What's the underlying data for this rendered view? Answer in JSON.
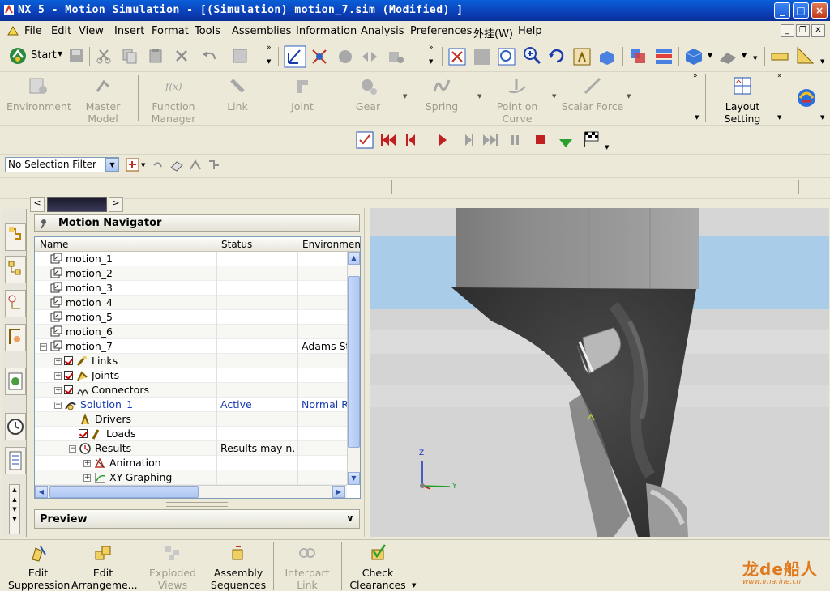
{
  "window": {
    "title": "NX 5 - Motion Simulation - [(Simulation) motion_7.sim (Modified) ]",
    "controls": [
      "_",
      "□",
      "×"
    ]
  },
  "menubar": {
    "items": [
      "File",
      "Edit",
      "View",
      "Insert",
      "Format",
      "Tools",
      "Assemblies",
      "Information",
      "Analysis",
      "Preferences",
      "外挂(W)",
      "Help"
    ]
  },
  "standard_toolbar": {
    "start_label": "Start"
  },
  "motion_toolbar": {
    "items": [
      {
        "label": "Environment"
      },
      {
        "label": "Master Model"
      },
      {
        "label": "Function Manager"
      },
      {
        "label": "Link"
      },
      {
        "label": "Joint"
      },
      {
        "label": "Gear"
      },
      {
        "label": "Spring"
      },
      {
        "label": "Point on Curve"
      },
      {
        "label": "Scalar Force"
      }
    ],
    "layout_setting": "Layout Setting"
  },
  "selection": {
    "filter_value": "No Selection Filter"
  },
  "navigator": {
    "title": "Motion Navigator",
    "columns": [
      "Name",
      "Status",
      "Environment"
    ],
    "rows": [
      {
        "name": "motion_1",
        "status": "",
        "env": ""
      },
      {
        "name": "motion_2",
        "status": "",
        "env": ""
      },
      {
        "name": "motion_3",
        "status": "",
        "env": ""
      },
      {
        "name": "motion_4",
        "status": "",
        "env": ""
      },
      {
        "name": "motion_5",
        "status": "",
        "env": ""
      },
      {
        "name": "motion_6",
        "status": "",
        "env": ""
      },
      {
        "name": "motion_7",
        "status": "",
        "env": "Adams St"
      },
      {
        "name": "Links",
        "status": "",
        "env": ""
      },
      {
        "name": "Joints",
        "status": "",
        "env": ""
      },
      {
        "name": "Connectors",
        "status": "",
        "env": ""
      },
      {
        "name": "Solution_1",
        "status": "Active",
        "env": "Normal R"
      },
      {
        "name": "Drivers",
        "status": "",
        "env": ""
      },
      {
        "name": "Loads",
        "status": "",
        "env": ""
      },
      {
        "name": "Results",
        "status": "Results may n...",
        "env": ""
      },
      {
        "name": "Animation",
        "status": "",
        "env": ""
      },
      {
        "name": "XY-Graphing",
        "status": "",
        "env": ""
      }
    ],
    "preview_label": "Preview"
  },
  "viewport": {
    "axis_labels": [
      "Z",
      "Y"
    ]
  },
  "bottom_toolbar": {
    "items": [
      {
        "label": "Edit Suppression"
      },
      {
        "label": "Edit Arrangeme..."
      },
      {
        "label": "Exploded Views"
      },
      {
        "label": "Assembly Sequences"
      },
      {
        "label": "Interpart Link"
      },
      {
        "label": "Check Clearances"
      }
    ]
  },
  "watermark": {
    "brand": "龙de船人",
    "url": "www.imarine.cn"
  },
  "colors": {
    "title_bar": "#0b3fb8",
    "chrome": "#ece9d8",
    "tree_blue_text": "#1a3bb0"
  }
}
